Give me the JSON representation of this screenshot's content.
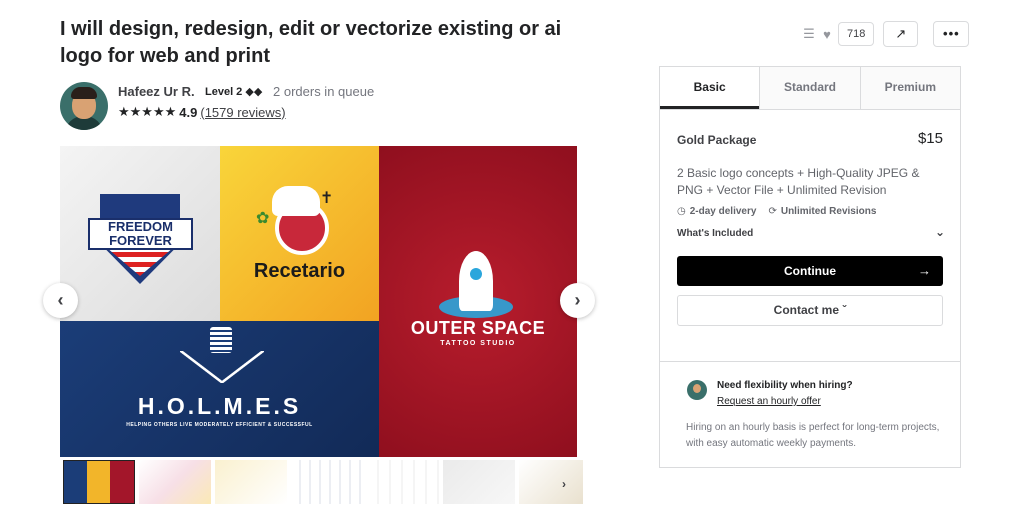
{
  "gig": {
    "title": "I will design, redesign, edit or vectorize existing or ai logo for web and print"
  },
  "seller": {
    "name": "Hafeez Ur R.",
    "level": "Level 2 ◆◆",
    "queue": "2 orders in queue",
    "stars": "★★★★★",
    "score": "4.9",
    "reviews": "(1579 reviews)"
  },
  "actions": {
    "likes": "718",
    "more": "•••"
  },
  "gallery": {
    "logos": {
      "freedom_line1": "FREEDOM",
      "freedom_line2": "FOREVER",
      "recetario": "Recetario",
      "outer_space": "OUTER SPACE",
      "outer_space_sub": "TATTOO STUDIO",
      "holmes": "H.O.L.M.E.S",
      "holmes_sub": "HELPING OTHERS LIVE MODERATELY EFFICIENT & SUCCESSFUL"
    }
  },
  "tabs": [
    "Basic",
    "Standard",
    "Premium"
  ],
  "package": {
    "name": "Gold Package",
    "price": "$15",
    "description": "2 Basic logo concepts + High-Quality JPEG & PNG + Vector File + Unlimited Revision",
    "delivery": "2-day delivery",
    "revisions": "Unlimited Revisions",
    "included": "What's Included",
    "continue": "Continue",
    "contact": "Contact me"
  },
  "hourly": {
    "title": "Need flexibility when hiring?",
    "link": "Request an hourly offer",
    "description": "Hiring on an hourly basis is perfect for long-term projects, with easy automatic weekly payments."
  },
  "colors": {
    "primary_button": "#000000",
    "text_dark": "#222325",
    "text_muted": "#74767e",
    "border": "#dadbdd"
  }
}
